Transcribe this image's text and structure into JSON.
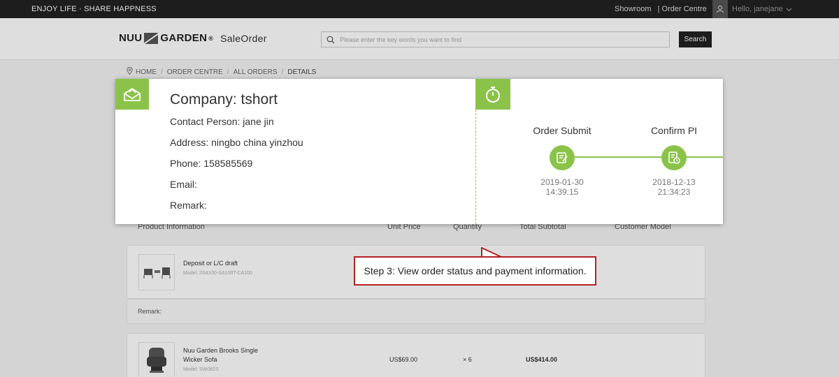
{
  "topbar": {
    "slogan": "ENJOY LIFE · SHARE HAPPNESS",
    "showroom": "Showroom",
    "order_centre": "| Order Centre",
    "greeting": "Hello, janejane"
  },
  "header": {
    "brand_left": "NUU",
    "brand_right": "GARDEN",
    "registered": "®",
    "subtitle": "SaleOrder",
    "search_placeholder": "Please enter the key words you want to find",
    "search_button": "Search"
  },
  "breadcrumb": [
    "HOME",
    "ORDER CENTRE",
    "ALL ORDERS",
    "DETAILS"
  ],
  "customer": {
    "company": "Company: tshort",
    "contact": "Contact Person: jane jin",
    "address": "Address: ningbo china yinzhou",
    "phone": "Phone: 158585569",
    "email": "Email:",
    "remark": "Remark:"
  },
  "steps": [
    {
      "title": "Order Submit",
      "date": "2019-01-30",
      "time": "14:39:15"
    },
    {
      "title": "Confirm PI",
      "date": "2018-12-13",
      "time": "21:34:23"
    }
  ],
  "table": {
    "headers": [
      "Product Information",
      "Unit Price",
      "Quantity",
      "Total Subtotal",
      "Customer Model"
    ],
    "rows": [
      {
        "name": "Deposit or L/C draft",
        "model": "Model: 2SA100-SA100T-CA100",
        "price": "",
        "qty": "",
        "subtotal": ""
      },
      {
        "name": "Nuu Garden Brooks Single Wicker Sofa",
        "model": "Model: SW082S",
        "price": "US$69.00",
        "qty": "× 6",
        "subtotal": "US$414.00"
      }
    ],
    "remark_label": "Remark:"
  },
  "callout": "Step 3: View order status and payment information.",
  "colors": {
    "accent": "#8bc34a",
    "callout_border": "#b22222"
  }
}
